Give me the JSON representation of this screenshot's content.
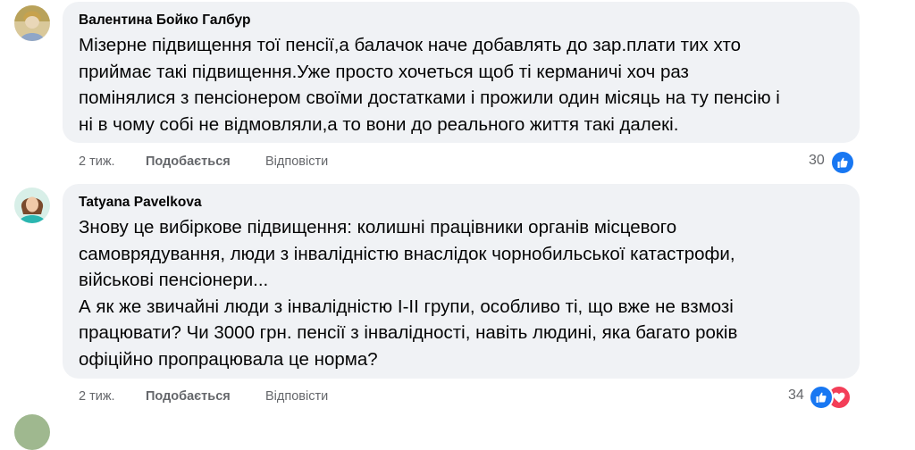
{
  "comments": [
    {
      "author": "Валентина Бойко Галбур",
      "text": "Мізерне підвищення тої пенсії,а балачок наче добавлять до зар.плати тих хто\nприймає такі підвищення.Уже просто хочеться щоб ті керманичі хоч раз\nпомінялися з пенсіонером своїми достатками і прожили один місяць на ту пенсію і\nні в чому собі не відмовляли,а то вони до реального життя такі далекі.",
      "time": "2 тиж.",
      "like_label": "Подобається",
      "reply_label": "Відповісти",
      "reaction_count": "30",
      "reactions": [
        "like"
      ]
    },
    {
      "author": "Tatyana Pavelkova",
      "text": "Знову це вибіркове підвищення: колишні працівники органів місцевого\nсамоврядування, люди з інвалідністю внаслідок чорнобильської катастрофи,\nвійськові пенсіонери...\nА як же звичайні люди з інвалідністю І-ІІ групи, особливо ті, що вже не взмозі\nпрацювати? Чи 3000 грн. пенсії з інвалідності, навіть людині, яка багато років\nофіційно пропрацювала це норма?",
      "time": "2 тиж.",
      "like_label": "Подобається",
      "reply_label": "Відповісти",
      "reaction_count": "34",
      "reactions": [
        "like",
        "love"
      ]
    }
  ],
  "colors": {
    "bubble_bg": "#f0f2f5",
    "meta_text": "#65676b",
    "like_blue": "#1877f2",
    "love_red": "#f33e58"
  }
}
